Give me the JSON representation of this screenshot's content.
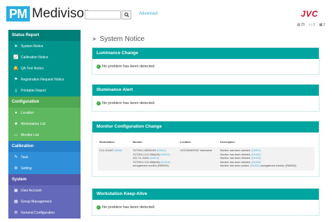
{
  "header": {
    "logo_prefix": "PM",
    "logo_text": "Medivisor",
    "search_placeholder": "",
    "advanced_label": "Advanced",
    "brand": "JVC",
    "stats": [
      {
        "icon": "monitor-stack-icon",
        "value": "25"
      },
      {
        "icon": "display-icon",
        "value": "1"
      },
      {
        "icon": "alert-icon",
        "value": "2"
      }
    ]
  },
  "sidebar": {
    "sections": [
      {
        "title": "Status Report",
        "items": [
          {
            "label": "System Notice",
            "icon": "send-icon"
          },
          {
            "label": "Calibration Notice",
            "icon": "chart-icon"
          },
          {
            "label": "QA Test Notice",
            "icon": "bell-icon"
          },
          {
            "label": "Registration Request Notice",
            "icon": "flag-icon"
          },
          {
            "label": "Printable Report",
            "icon": "document-icon"
          }
        ]
      },
      {
        "title": "Configuration",
        "items": [
          {
            "label": "Location",
            "icon": "map-pin-icon"
          },
          {
            "label": "Workstation List",
            "icon": "list-icon"
          },
          {
            "label": "Monitor List",
            "icon": "monitor-icon"
          }
        ]
      },
      {
        "title": "Calibration",
        "items": [
          {
            "label": "Task",
            "icon": "wrench-icon"
          },
          {
            "label": "Setting",
            "icon": "gears-icon"
          }
        ]
      },
      {
        "title": "System",
        "items": [
          {
            "label": "User Account",
            "icon": "user-card-icon"
          },
          {
            "label": "Group Management",
            "icon": "group-icon"
          },
          {
            "label": "General Configuration",
            "icon": "gear-icon"
          }
        ]
      }
    ]
  },
  "main": {
    "title": "System Notice",
    "panels": {
      "luminance": {
        "title": "Luminance Change",
        "message": "No problem has been detected."
      },
      "illuminance": {
        "title": "Illuminance Alert",
        "message": "No problem has been detected."
      },
      "monitor_config": {
        "title": "Monitor Configuration Change",
        "columns": [
          "Workstation",
          "Monitor",
          "Location",
          "Description"
        ],
        "row": {
          "workstation": "CL2-101187",
          "workstation_link": "(0046)",
          "monitors": [
            {
              "name": "TOTOKU ME552U9",
              "id": "(D0401)"
            },
            {
              "name": "TOTOKU CCL358(UM)",
              "id": "(D0402)"
            },
            {
              "name": "JVC CL-S200",
              "id": "(D0403)"
            },
            {
              "name": "TOTOKU CCL358(UM)",
              "id": "(D0404)"
            },
            {
              "name": "unregistered monitor (R60005)",
              "id": ""
            }
          ],
          "location": "JVCKENWOOD Yokohama",
          "descriptions": [
            {
              "text": "Monitor has been deleted.",
              "id": "(D0401)",
              "suffix": ""
            },
            {
              "text": "Monitor has been deleted.",
              "id": "(D0402)",
              "suffix": ""
            },
            {
              "text": "Monitor has been deleted.",
              "id": "(D0403)",
              "suffix": ""
            },
            {
              "text": "Monitor has been deleted.",
              "id": "(D0404)",
              "suffix": ""
            },
            {
              "text": "Monitor has been added.",
              "id": "(D0405)",
              "suffix": "unregistered monitor (R60005)"
            }
          ]
        }
      },
      "keepalive": {
        "title": "Workstation Keep-Alive",
        "message": "No problem has been detected."
      }
    }
  }
}
